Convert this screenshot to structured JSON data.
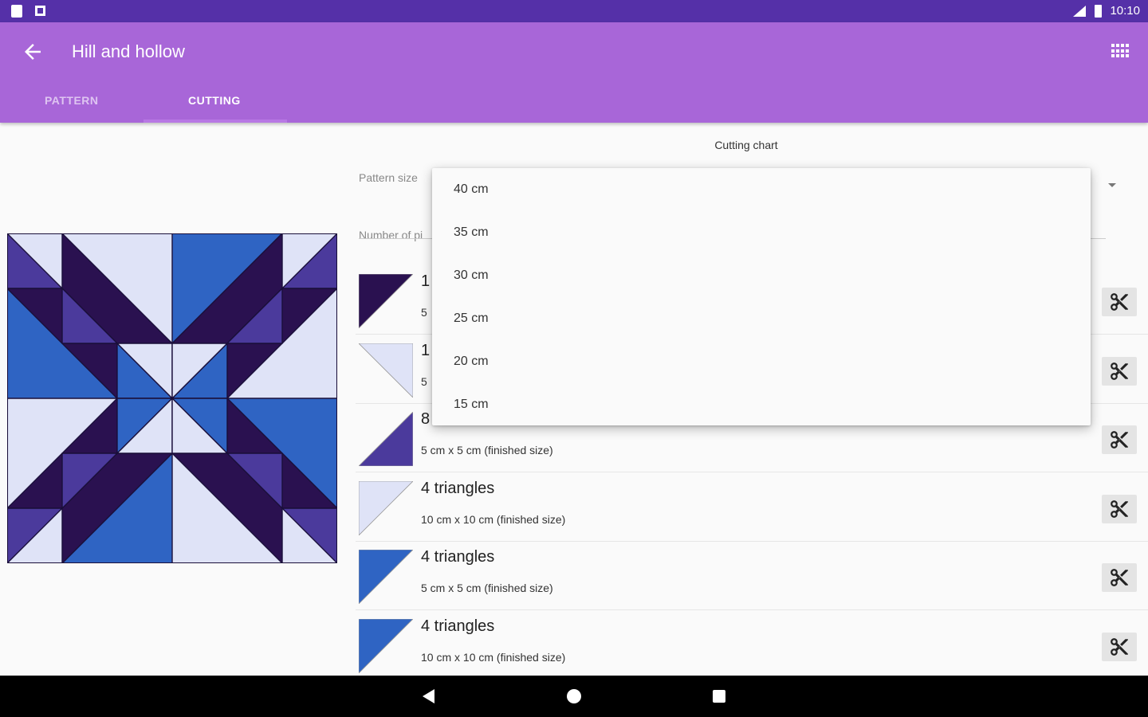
{
  "status_bar": {
    "time": "10:10"
  },
  "app_bar": {
    "title": "Hill and hollow",
    "back_icon": "arrow-back-icon",
    "grid_icon": "grid-icon"
  },
  "tabs": [
    {
      "label": "PATTERN"
    },
    {
      "label": "CUTTING"
    }
  ],
  "cutting": {
    "title": "Cutting chart",
    "pattern_size_label": "Pattern size",
    "pieces_label": "Number of pi",
    "rows": [
      {
        "count": "1",
        "dims": "5",
        "color": "#2a1150"
      },
      {
        "count": "1",
        "dims": "5",
        "color": "#dfe3f7"
      },
      {
        "count": "8",
        "dims": "5 cm x 5 cm (finished size)",
        "color": "#4b3a9c"
      },
      {
        "count": "4 triangles",
        "dims": "10 cm x 10 cm (finished size)",
        "color": "#dfe3f7"
      },
      {
        "count": "4 triangles",
        "dims": "5 cm x 5 cm (finished size)",
        "color": "#2f64c3"
      },
      {
        "count": "4 triangles",
        "dims": "10 cm x 10 cm (finished size)",
        "color": "#2f64c3"
      }
    ]
  },
  "dropdown": {
    "options": [
      "40 cm",
      "35 cm",
      "30 cm",
      "25 cm",
      "20 cm",
      "15 cm"
    ]
  },
  "colors": {
    "status": "#5530a8",
    "appbar": "#a866d8",
    "dark": "#2a1150",
    "purple": "#4b3a9c",
    "blue": "#2f64c3",
    "light": "#dfe3f7"
  }
}
